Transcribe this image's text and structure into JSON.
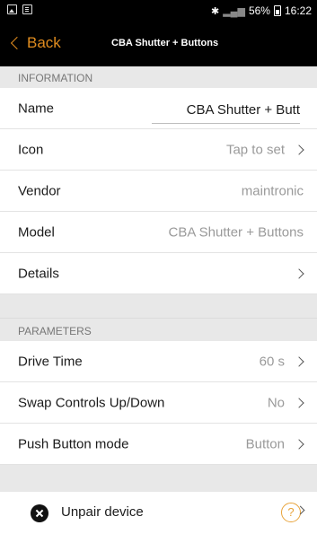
{
  "status": {
    "battery": "56%",
    "time": "16:22"
  },
  "nav": {
    "back_label": "Back",
    "title": "CBA Shutter + Buttons"
  },
  "info": {
    "header": "INFORMATION",
    "name_label": "Name",
    "name_value": "CBA Shutter + Butt",
    "icon_label": "Icon",
    "icon_value": "Tap to set",
    "vendor_label": "Vendor",
    "vendor_value": "maintronic",
    "model_label": "Model",
    "model_value": "CBA Shutter + Buttons",
    "details_label": "Details"
  },
  "params": {
    "header": "PARAMETERS",
    "drive_label": "Drive Time",
    "drive_value": "60 s",
    "swap_label": "Swap Controls Up/Down",
    "swap_value": "No",
    "push_label": "Push Button mode",
    "push_value": "Button"
  },
  "unpair": {
    "label": "Unpair device",
    "help": "?"
  },
  "colors": {
    "accent": "#e08c1f",
    "background": "#e8e8e8"
  }
}
